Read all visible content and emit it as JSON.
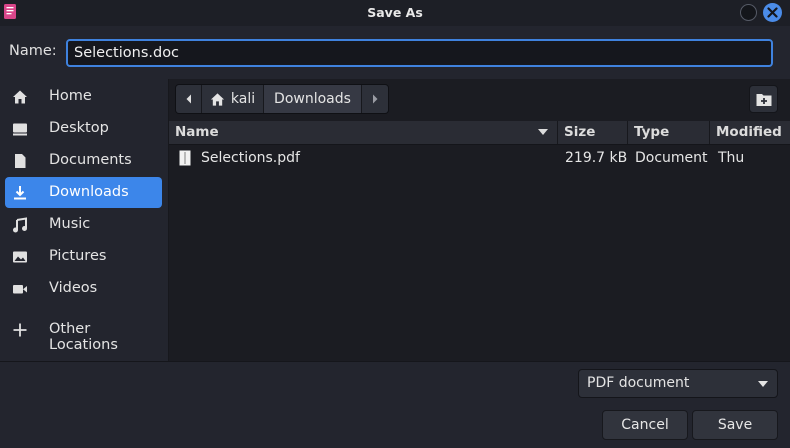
{
  "window": {
    "title": "Save As"
  },
  "name_field": {
    "label": "Name:",
    "value": "Selections.doc"
  },
  "sidebar": {
    "items": [
      {
        "label": "Home",
        "icon": "home-icon"
      },
      {
        "label": "Desktop",
        "icon": "desktop-icon"
      },
      {
        "label": "Documents",
        "icon": "documents-icon"
      },
      {
        "label": "Downloads",
        "icon": "download-icon",
        "active": true
      },
      {
        "label": "Music",
        "icon": "music-icon"
      },
      {
        "label": "Pictures",
        "icon": "pictures-icon"
      },
      {
        "label": "Videos",
        "icon": "videos-icon"
      },
      {
        "label": "Other Locations",
        "icon": "plus-icon"
      }
    ]
  },
  "path_bar": {
    "home_label": "kali",
    "current_label": "Downloads"
  },
  "columns": {
    "name": "Name",
    "size": "Size",
    "type": "Type",
    "modified": "Modified"
  },
  "files": [
    {
      "name": "Selections.pdf",
      "size": "219.7 kB",
      "type": "Document",
      "modified": "Thu"
    }
  ],
  "filter": {
    "selected": "PDF document"
  },
  "buttons": {
    "cancel": "Cancel",
    "save": "Save"
  },
  "colors": {
    "accent": "#3c86ea",
    "background": "#23252e",
    "content": "#1b1c22"
  }
}
